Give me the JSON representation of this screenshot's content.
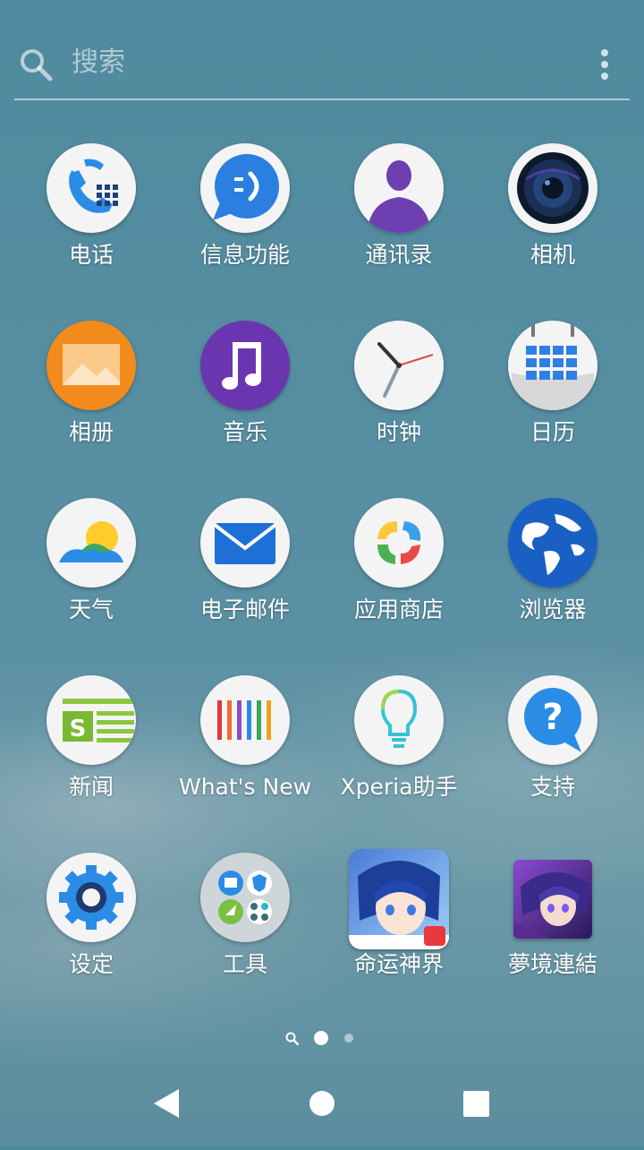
{
  "search": {
    "placeholder": "搜索",
    "icon": "search-icon",
    "menu_icon": "more-vert-icon"
  },
  "apps": [
    {
      "label": "电话",
      "icon": "phone-icon"
    },
    {
      "label": "信息功能",
      "icon": "messaging-icon"
    },
    {
      "label": "通讯录",
      "icon": "contacts-icon"
    },
    {
      "label": "相机",
      "icon": "camera-icon"
    },
    {
      "label": "相册",
      "icon": "album-icon"
    },
    {
      "label": "音乐",
      "icon": "music-icon"
    },
    {
      "label": "时钟",
      "icon": "clock-icon"
    },
    {
      "label": "日历",
      "icon": "calendar-icon"
    },
    {
      "label": "天气",
      "icon": "weather-icon"
    },
    {
      "label": "电子邮件",
      "icon": "email-icon"
    },
    {
      "label": "应用商店",
      "icon": "app-store-icon"
    },
    {
      "label": "浏览器",
      "icon": "browser-icon"
    },
    {
      "label": "新闻",
      "icon": "news-icon"
    },
    {
      "label": "What's New",
      "icon": "whats-new-icon"
    },
    {
      "label": "Xperia助手",
      "icon": "xperia-assist-icon"
    },
    {
      "label": "支持",
      "icon": "support-icon"
    },
    {
      "label": "设定",
      "icon": "settings-icon"
    },
    {
      "label": "工具",
      "icon": "tools-folder-icon"
    },
    {
      "label": "命运神界",
      "icon": "game-icon"
    },
    {
      "label": "夢境連結",
      "icon": "game-icon"
    }
  ],
  "page_indicator": {
    "pages": 2,
    "current": 1
  },
  "navigation": {
    "back": "back-icon",
    "home": "home-icon",
    "recents": "recents-icon"
  },
  "colors": {
    "background": "#568ea2",
    "accent_blue": "#2b8ce6",
    "purple": "#6e3fb0"
  }
}
